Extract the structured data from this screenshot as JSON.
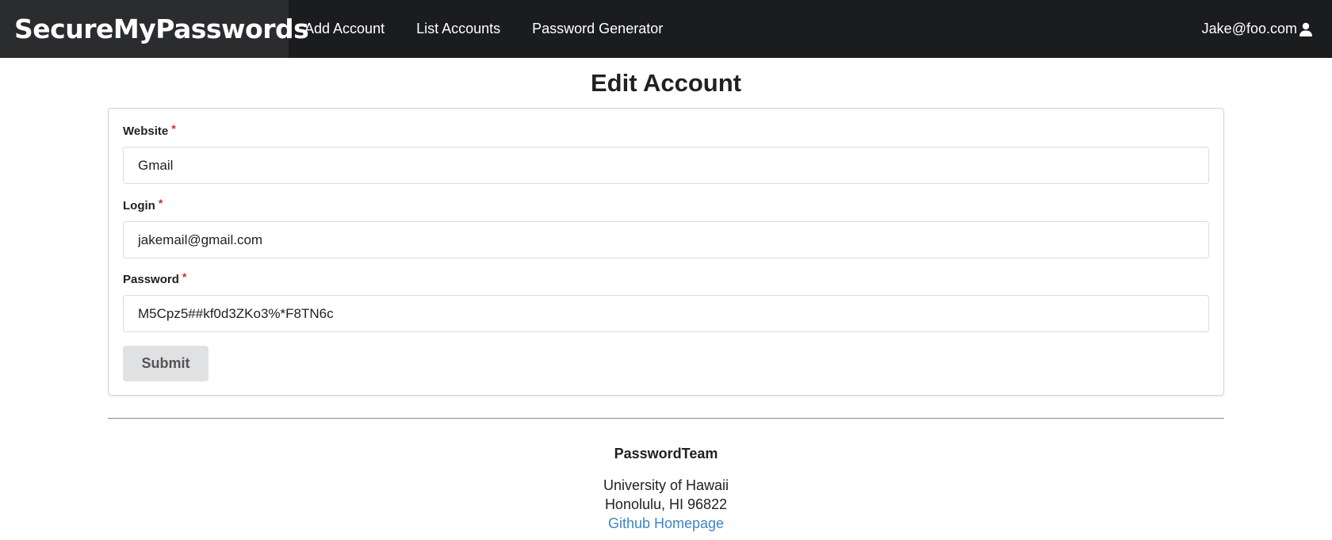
{
  "navbar": {
    "brand": "SecureMyPasswords",
    "items": [
      {
        "label": "Add Account"
      },
      {
        "label": "List Accounts"
      },
      {
        "label": "Password Generator"
      }
    ],
    "user": {
      "email": "Jake@foo.com",
      "icon": "user-icon"
    }
  },
  "page": {
    "title": "Edit Account"
  },
  "form": {
    "fields": [
      {
        "label": "Website",
        "required_mark": "*",
        "value": "Gmail"
      },
      {
        "label": "Login",
        "required_mark": "*",
        "value": "jakemail@gmail.com"
      },
      {
        "label": "Password",
        "required_mark": "*",
        "value": "M5Cpz5##kf0d3ZKo3%*F8TN6c"
      }
    ],
    "submit_label": "Submit"
  },
  "footer": {
    "team": "PasswordTeam",
    "line1": "University of Hawaii",
    "line2": "Honolulu, HI 96822",
    "link": "Github Homepage"
  },
  "colors": {
    "navbar_bg": "#1b1c1d",
    "brand_bg": "#2b2c2d",
    "required": "#db2828",
    "link": "#4183c4",
    "button_bg": "#e0e1e2"
  }
}
